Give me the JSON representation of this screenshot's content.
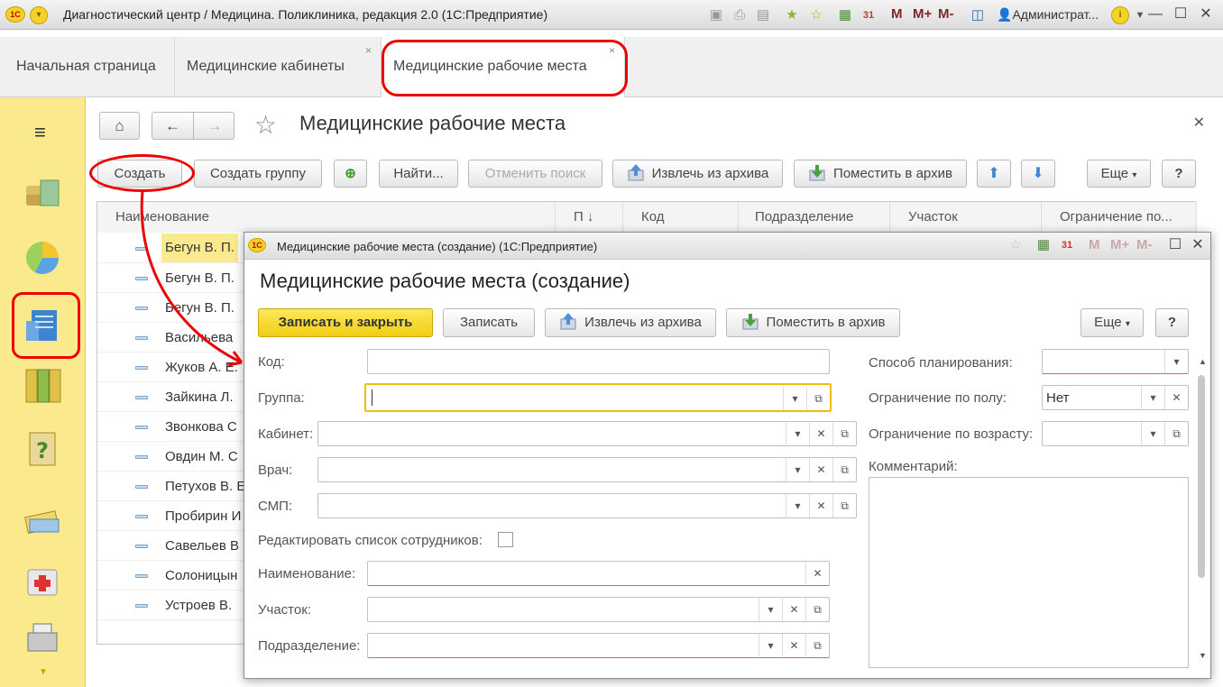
{
  "titlebar": {
    "logo": "1C",
    "title": "Диагностический центр / Медицина. Поликлиника, редакция 2.0  (1С:Предприятие)",
    "m": "M",
    "mplus": "M+",
    "mminus": "M-",
    "user": "Администрат...",
    "info": "i"
  },
  "tabs": [
    {
      "label": "Начальная страница"
    },
    {
      "label": "Медицинские кабинеты"
    },
    {
      "label": "Медицинские рабочие места"
    }
  ],
  "page": {
    "title": "Медицинские рабочие места",
    "buttons": {
      "create": "Создать",
      "create_group": "Создать группу",
      "find": "Найти...",
      "cancel_search": "Отменить поиск",
      "extract": "Извлечь из архива",
      "archive": "Поместить в архив",
      "more": "Еще",
      "help": "?"
    },
    "columns": [
      "Наименование",
      "П ↓",
      "Код",
      "Подразделение",
      "Участок",
      "Ограничение по..."
    ],
    "rows": [
      "Бегун В. П.",
      "Бегун В. П.",
      "Бегун В. П.",
      "Васильева",
      "Жуков А. Е.",
      "Зайкина Л.",
      "Звонкова С",
      "Овдин М. С",
      "Петухов В. Е",
      "Пробирин И",
      "Савельев В",
      "Солоницын",
      "Устроев В."
    ]
  },
  "modal": {
    "window_title": "Медицинские рабочие места (создание)  (1С:Предприятие)",
    "title": "Медицинские рабочие места (создание)",
    "buttons": {
      "save_close": "Записать и закрыть",
      "save": "Записать",
      "extract": "Извлечь из архива",
      "archive": "Поместить в архив",
      "more": "Еще",
      "help": "?"
    },
    "labels": {
      "code": "Код:",
      "group": "Группа:",
      "cabinet": "Кабинет:",
      "doctor": "Врач:",
      "smp": "СМП:",
      "edit_staff": "Редактировать список сотрудников:",
      "name": "Наименование:",
      "district": "Участок:",
      "department": "Подразделение:",
      "planning": "Способ планирования:",
      "sex_limit": "Ограничение по полу:",
      "age_limit": "Ограничение по возрасту:",
      "comment": "Комментарий:"
    },
    "values": {
      "code": "",
      "group": "",
      "cabinet": "",
      "doctor": "",
      "smp": "",
      "name": "",
      "district": "",
      "department": "",
      "planning": "",
      "sex_limit": "Нет",
      "age_limit": "",
      "comment": ""
    },
    "edit_staff_checked": false
  },
  "colors": {
    "sidebar": "#fbe98d",
    "accent_yellow": "#f2cd14",
    "highlight_row": "#fbe98d",
    "annotation_red": "#ee0000"
  }
}
